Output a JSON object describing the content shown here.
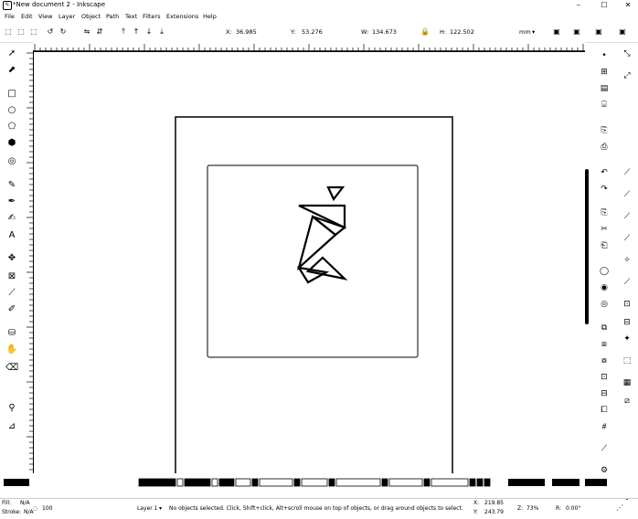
{
  "window": {
    "title": "*New document 2 - Inkscape",
    "controls": [
      "–",
      "☐",
      "✕"
    ]
  },
  "menu": [
    "File",
    "Edit",
    "View",
    "Layer",
    "Object",
    "Path",
    "Text",
    "Filters",
    "Extensions",
    "Help"
  ],
  "controlbar": {
    "x_label": "X:",
    "x_value": "36.985",
    "y_label": "Y:",
    "y_value": "53.276",
    "w_label": "W:",
    "w_value": "134.673",
    "h_label": "H:",
    "h_value": "122.502",
    "unit": "mm"
  },
  "tools": [
    "selector-icon",
    "node-icon",
    "rect-icon",
    "ellipse-icon",
    "star-icon",
    "3dbox-icon",
    "spiral-icon",
    "pencil-icon",
    "pen-icon",
    "calligraphy-icon",
    "text-icon",
    "spray-icon",
    "mesh-icon",
    "gradient-icon",
    "dropper-icon",
    "paintbucket-icon",
    "tweak-icon",
    "eraser-icon",
    "zoom-icon",
    "measure-icon"
  ],
  "status": {
    "fill_label": "Fill:",
    "fill_value": "N/A",
    "stroke_label": "Stroke:",
    "stroke_value": "N/A",
    "opacity_value": "100",
    "layer": "Layer 1",
    "message": "No objects selected. Click, Shift+click, Alt+scroll mouse on top of objects, or drag around objects to select.",
    "x_label": "X:",
    "x_value": "219.85",
    "y_label": "Y:",
    "y_value": "243.79",
    "zoom_label": "Z:",
    "zoom_value": "73%",
    "rotation_label": "R:",
    "rotation_value": "0.00°"
  },
  "colors": {
    "stroke": "#000000",
    "background": "#ffffff",
    "palette_bg": "#dddddd"
  }
}
